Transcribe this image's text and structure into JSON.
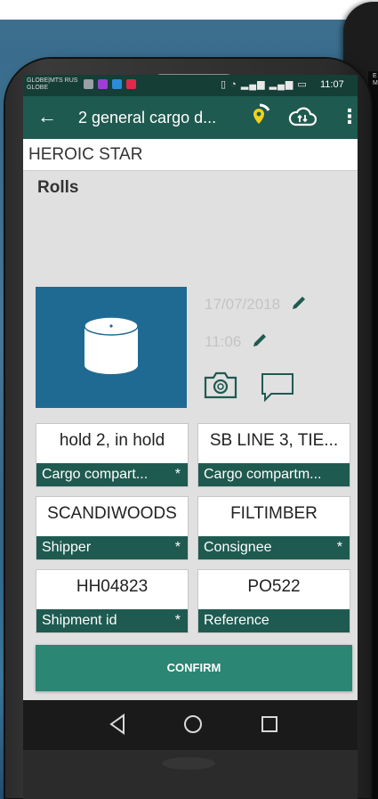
{
  "second_device": {
    "carrier_text": "E\nM"
  },
  "status_bar": {
    "carrier_line1": "GLOBE|MTS RUS",
    "carrier_line2": "GLOBE",
    "time": "11:07",
    "notification_colors": [
      "#9aa0a6",
      "#9c3fd6",
      "#2a8cd8",
      "#e0284b"
    ]
  },
  "app_bar": {
    "title": "2 general cargo d...",
    "color": "#1f5a50"
  },
  "vessel": {
    "name": "HEROIC STAR"
  },
  "cargo": {
    "type": "Rolls",
    "date": "17/07/2018",
    "time": "11:06",
    "tile_color": "#1e6a93"
  },
  "fields": [
    {
      "value": "hold 2, in hold",
      "label": "Cargo compart...",
      "required": "*"
    },
    {
      "value": "SB LINE 3, TIE...",
      "label": "Cargo compartm...",
      "required": ""
    },
    {
      "value": "SCANDIWOODS",
      "label": "Shipper",
      "required": "*"
    },
    {
      "value": "FILTIMBER",
      "label": "Consignee",
      "required": "*"
    },
    {
      "value": "HH04823",
      "label": "Shipment id",
      "required": "*"
    },
    {
      "value": "PO522",
      "label": "Reference",
      "required": ""
    }
  ],
  "actions": {
    "confirm_label": "CONFIRM",
    "confirm_color": "#2b8673"
  }
}
